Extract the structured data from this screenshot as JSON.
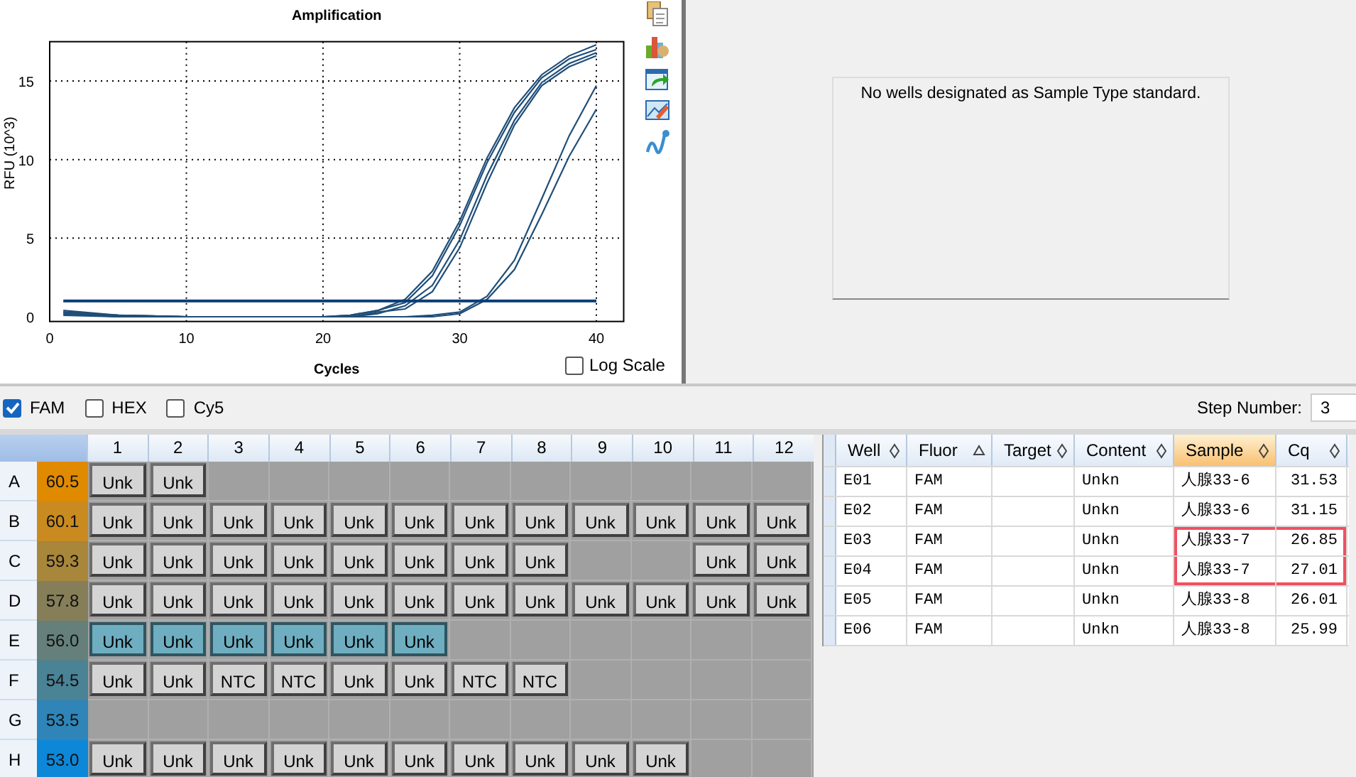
{
  "chart": {
    "chart_data": {
      "type": "line",
      "title": "Amplification",
      "xlabel": "Cycles",
      "ylabel": "RFU (10^3)",
      "x": [
        1,
        5,
        10,
        15,
        20,
        22,
        24,
        26,
        28,
        30,
        32,
        34,
        36,
        38,
        40
      ],
      "xlim": [
        0,
        42
      ],
      "ylim": [
        -0.3,
        17.5
      ],
      "xticks": [
        0,
        10,
        20,
        30,
        40
      ],
      "yticks": [
        0,
        5,
        10,
        15
      ],
      "grid": true,
      "series": [
        {
          "color": "#1f4e79",
          "values": [
            0.3,
            0.1,
            0,
            0,
            0,
            0,
            0.3,
            0.5,
            1.6,
            4.4,
            8.5,
            12.2,
            14.7,
            15.9,
            16.6
          ]
        },
        {
          "color": "#1f4e79",
          "values": [
            0.2,
            0,
            0,
            0,
            0,
            0,
            0.2,
            0.7,
            2.0,
            4.9,
            9.0,
            12.5,
            14.9,
            16.1,
            16.8
          ]
        },
        {
          "color": "#1f4e79",
          "values": [
            0.1,
            0,
            0,
            0,
            0,
            0.1,
            0.4,
            0.9,
            2.6,
            5.8,
            9.8,
            13.0,
            15.2,
            16.4,
            17.0
          ]
        },
        {
          "color": "#1f4e79",
          "values": [
            0.4,
            0.1,
            0,
            0,
            0,
            0.1,
            0.4,
            1.1,
            2.9,
            6.1,
            10.1,
            13.3,
            15.4,
            16.6,
            17.3
          ]
        },
        {
          "color": "#1f4e79",
          "values": [
            0.2,
            0.1,
            0,
            0,
            0,
            0,
            0,
            0,
            0.1,
            0.3,
            1.3,
            3.6,
            7.5,
            11.5,
            14.7
          ]
        },
        {
          "color": "#1f4e79",
          "values": [
            0.3,
            0,
            0,
            0,
            0,
            0,
            0,
            0,
            0,
            0.2,
            1.1,
            3.0,
            6.5,
            10.2,
            13.2
          ]
        },
        {
          "color": "#0b3d75",
          "values": [
            1,
            1,
            1,
            1,
            1,
            1,
            1,
            1,
            1,
            1,
            1,
            1,
            1,
            1,
            1
          ]
        }
      ]
    },
    "log_scale": {
      "label": "Log Scale",
      "checked": false
    }
  },
  "standard_curve": {
    "message": "No wells designated as Sample Type standard."
  },
  "fluors": [
    {
      "label": "FAM",
      "checked": true
    },
    {
      "label": "HEX",
      "checked": false
    },
    {
      "label": "Cy5",
      "checked": false
    }
  ],
  "step_number": {
    "label": "Step Number:",
    "value": "3"
  },
  "plate": {
    "columns": [
      "1",
      "2",
      "3",
      "4",
      "5",
      "6",
      "7",
      "8",
      "9",
      "10",
      "11",
      "12"
    ],
    "rows": [
      {
        "letter": "A",
        "temp": "60.5",
        "color": "#e08a00",
        "wells": [
          {
            "kind": "sample",
            "label": "Unk",
            "selected": false
          },
          {
            "kind": "sample",
            "label": "Unk",
            "selected": false
          },
          {
            "kind": "empty"
          },
          {
            "kind": "empty"
          },
          {
            "kind": "empty"
          },
          {
            "kind": "empty"
          },
          {
            "kind": "empty"
          },
          {
            "kind": "empty"
          },
          {
            "kind": "empty"
          },
          {
            "kind": "empty"
          },
          {
            "kind": "empty"
          },
          {
            "kind": "empty"
          }
        ]
      },
      {
        "letter": "B",
        "temp": "60.1",
        "color": "#c98a1f",
        "wells": [
          {
            "kind": "sample",
            "label": "Unk",
            "selected": false
          },
          {
            "kind": "sample",
            "label": "Unk",
            "selected": false
          },
          {
            "kind": "sample",
            "label": "Unk",
            "selected": false
          },
          {
            "kind": "sample",
            "label": "Unk",
            "selected": false
          },
          {
            "kind": "sample",
            "label": "Unk",
            "selected": false
          },
          {
            "kind": "sample",
            "label": "Unk",
            "selected": false
          },
          {
            "kind": "sample",
            "label": "Unk",
            "selected": false
          },
          {
            "kind": "sample",
            "label": "Unk",
            "selected": false
          },
          {
            "kind": "sample",
            "label": "Unk",
            "selected": false
          },
          {
            "kind": "sample",
            "label": "Unk",
            "selected": false
          },
          {
            "kind": "sample",
            "label": "Unk",
            "selected": false
          },
          {
            "kind": "sample",
            "label": "Unk",
            "selected": false
          }
        ]
      },
      {
        "letter": "C",
        "temp": "59.3",
        "color": "#a8863a",
        "wells": [
          {
            "kind": "sample",
            "label": "Unk",
            "selected": false
          },
          {
            "kind": "sample",
            "label": "Unk",
            "selected": false
          },
          {
            "kind": "sample",
            "label": "Unk",
            "selected": false
          },
          {
            "kind": "sample",
            "label": "Unk",
            "selected": false
          },
          {
            "kind": "sample",
            "label": "Unk",
            "selected": false
          },
          {
            "kind": "sample",
            "label": "Unk",
            "selected": false
          },
          {
            "kind": "sample",
            "label": "Unk",
            "selected": false
          },
          {
            "kind": "sample",
            "label": "Unk",
            "selected": false
          },
          {
            "kind": "empty"
          },
          {
            "kind": "empty"
          },
          {
            "kind": "sample",
            "label": "Unk",
            "selected": false
          },
          {
            "kind": "sample",
            "label": "Unk",
            "selected": false
          }
        ]
      },
      {
        "letter": "D",
        "temp": "57.8",
        "color": "#867e58",
        "wells": [
          {
            "kind": "sample",
            "label": "Unk",
            "selected": false
          },
          {
            "kind": "sample",
            "label": "Unk",
            "selected": false
          },
          {
            "kind": "sample",
            "label": "Unk",
            "selected": false
          },
          {
            "kind": "sample",
            "label": "Unk",
            "selected": false
          },
          {
            "kind": "sample",
            "label": "Unk",
            "selected": false
          },
          {
            "kind": "sample",
            "label": "Unk",
            "selected": false
          },
          {
            "kind": "sample",
            "label": "Unk",
            "selected": false
          },
          {
            "kind": "sample",
            "label": "Unk",
            "selected": false
          },
          {
            "kind": "sample",
            "label": "Unk",
            "selected": false
          },
          {
            "kind": "sample",
            "label": "Unk",
            "selected": false
          },
          {
            "kind": "sample",
            "label": "Unk",
            "selected": false
          },
          {
            "kind": "sample",
            "label": "Unk",
            "selected": false
          }
        ]
      },
      {
        "letter": "E",
        "temp": "56.0",
        "color": "#65807a",
        "wells": [
          {
            "kind": "sample",
            "label": "Unk",
            "selected": true
          },
          {
            "kind": "sample",
            "label": "Unk",
            "selected": true
          },
          {
            "kind": "sample",
            "label": "Unk",
            "selected": true
          },
          {
            "kind": "sample",
            "label": "Unk",
            "selected": true
          },
          {
            "kind": "sample",
            "label": "Unk",
            "selected": true
          },
          {
            "kind": "sample",
            "label": "Unk",
            "selected": true
          },
          {
            "kind": "empty"
          },
          {
            "kind": "empty"
          },
          {
            "kind": "empty"
          },
          {
            "kind": "empty"
          },
          {
            "kind": "empty"
          },
          {
            "kind": "empty"
          }
        ]
      },
      {
        "letter": "F",
        "temp": "54.5",
        "color": "#4a8296",
        "wells": [
          {
            "kind": "sample",
            "label": "Unk",
            "selected": false
          },
          {
            "kind": "sample",
            "label": "Unk",
            "selected": false
          },
          {
            "kind": "sample",
            "label": "NTC",
            "selected": false
          },
          {
            "kind": "sample",
            "label": "NTC",
            "selected": false
          },
          {
            "kind": "sample",
            "label": "Unk",
            "selected": false
          },
          {
            "kind": "sample",
            "label": "Unk",
            "selected": false
          },
          {
            "kind": "sample",
            "label": "NTC",
            "selected": false
          },
          {
            "kind": "sample",
            "label": "NTC",
            "selected": false
          },
          {
            "kind": "empty"
          },
          {
            "kind": "empty"
          },
          {
            "kind": "empty"
          },
          {
            "kind": "empty"
          }
        ]
      },
      {
        "letter": "G",
        "temp": "53.5",
        "color": "#2f84b8",
        "wells": [
          {
            "kind": "empty"
          },
          {
            "kind": "empty"
          },
          {
            "kind": "empty"
          },
          {
            "kind": "empty"
          },
          {
            "kind": "empty"
          },
          {
            "kind": "empty"
          },
          {
            "kind": "empty"
          },
          {
            "kind": "empty"
          },
          {
            "kind": "empty"
          },
          {
            "kind": "empty"
          },
          {
            "kind": "empty"
          },
          {
            "kind": "empty"
          }
        ]
      },
      {
        "letter": "H",
        "temp": "53.0",
        "color": "#0d87d8",
        "wells": [
          {
            "kind": "sample",
            "label": "Unk",
            "selected": false
          },
          {
            "kind": "sample",
            "label": "Unk",
            "selected": false
          },
          {
            "kind": "sample",
            "label": "Unk",
            "selected": false
          },
          {
            "kind": "sample",
            "label": "Unk",
            "selected": false
          },
          {
            "kind": "sample",
            "label": "Unk",
            "selected": false
          },
          {
            "kind": "sample",
            "label": "Unk",
            "selected": false
          },
          {
            "kind": "sample",
            "label": "Unk",
            "selected": false
          },
          {
            "kind": "sample",
            "label": "Unk",
            "selected": false
          },
          {
            "kind": "sample",
            "label": "Unk",
            "selected": false
          },
          {
            "kind": "sample",
            "label": "Unk",
            "selected": false
          },
          {
            "kind": "empty"
          },
          {
            "kind": "empty"
          }
        ]
      }
    ]
  },
  "results": {
    "columns": [
      {
        "label": "Well",
        "sorted": false,
        "selected": false
      },
      {
        "label": "Fluor",
        "sorted": true,
        "selected": false
      },
      {
        "label": "Target",
        "sorted": false,
        "selected": false
      },
      {
        "label": "Content",
        "sorted": false,
        "selected": false
      },
      {
        "label": "Sample",
        "sorted": false,
        "selected": true
      },
      {
        "label": "Cq",
        "sorted": false,
        "selected": false
      }
    ],
    "rows": [
      {
        "cells": [
          "E01",
          "FAM",
          "",
          "Unkn",
          "人腺33-6",
          "31.53"
        ],
        "highlighted": false
      },
      {
        "cells": [
          "E02",
          "FAM",
          "",
          "Unkn",
          "人腺33-6",
          "31.15"
        ],
        "highlighted": false
      },
      {
        "cells": [
          "E03",
          "FAM",
          "",
          "Unkn",
          "人腺33-7",
          "26.85"
        ],
        "highlighted": true
      },
      {
        "cells": [
          "E04",
          "FAM",
          "",
          "Unkn",
          "人腺33-7",
          "27.01"
        ],
        "highlighted": true
      },
      {
        "cells": [
          "E05",
          "FAM",
          "",
          "Unkn",
          "人腺33-8",
          "26.01"
        ],
        "highlighted": false
      },
      {
        "cells": [
          "E06",
          "FAM",
          "",
          "Unkn",
          "人腺33-8",
          "25.99"
        ],
        "highlighted": false
      }
    ]
  }
}
